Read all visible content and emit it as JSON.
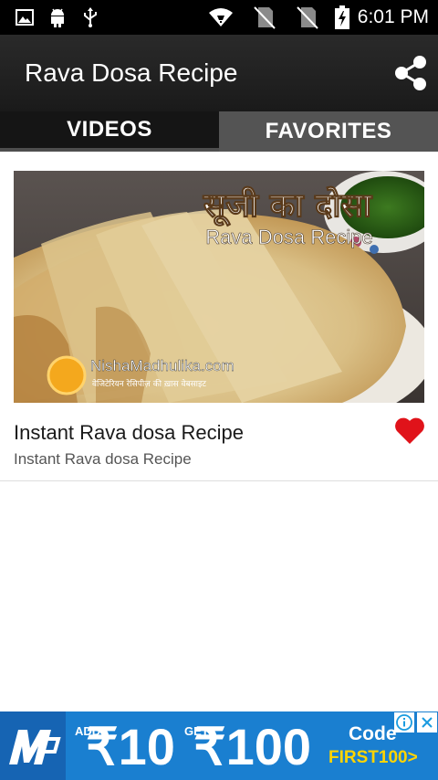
{
  "status_bar": {
    "time": "6:01 PM",
    "icons": [
      "image-icon",
      "android-icon",
      "usb-icon",
      "wifi-icon",
      "no-sim-icon",
      "no-sim-icon",
      "battery-charging-icon"
    ]
  },
  "app_bar": {
    "title": "Rava Dosa Recipe",
    "share_icon": "share-icon"
  },
  "tabs": [
    {
      "label": "VIDEOS",
      "active": true
    },
    {
      "label": "FAVORITES",
      "active": false
    }
  ],
  "videos": [
    {
      "thumbnail": {
        "hindi_title": "सूजी का दोसा",
        "overlay_title": "Rava Dosa Recipe",
        "watermark": "NishaMadhulika.com",
        "watermark_sub": "वेजिटेरियन रेसिपीज़ की ख़ास वेबसाइट"
      },
      "title": "Instant Rava dosa Recipe",
      "subtitle": "Instant Rava dosa Recipe",
      "favorite_icon": "heart-icon",
      "favorite_color": "#e0131a"
    }
  ],
  "ad": {
    "add_label": "ADD",
    "add_amount": "₹10",
    "get_label": "GET",
    "get_amount": "₹100",
    "code_label": "Code",
    "code_value": "FIRST100>",
    "info_icon": "info-icon",
    "close_icon": "close-icon",
    "brand_icon": "mobikwik-logo-icon",
    "accent_color": "#ffd400"
  }
}
